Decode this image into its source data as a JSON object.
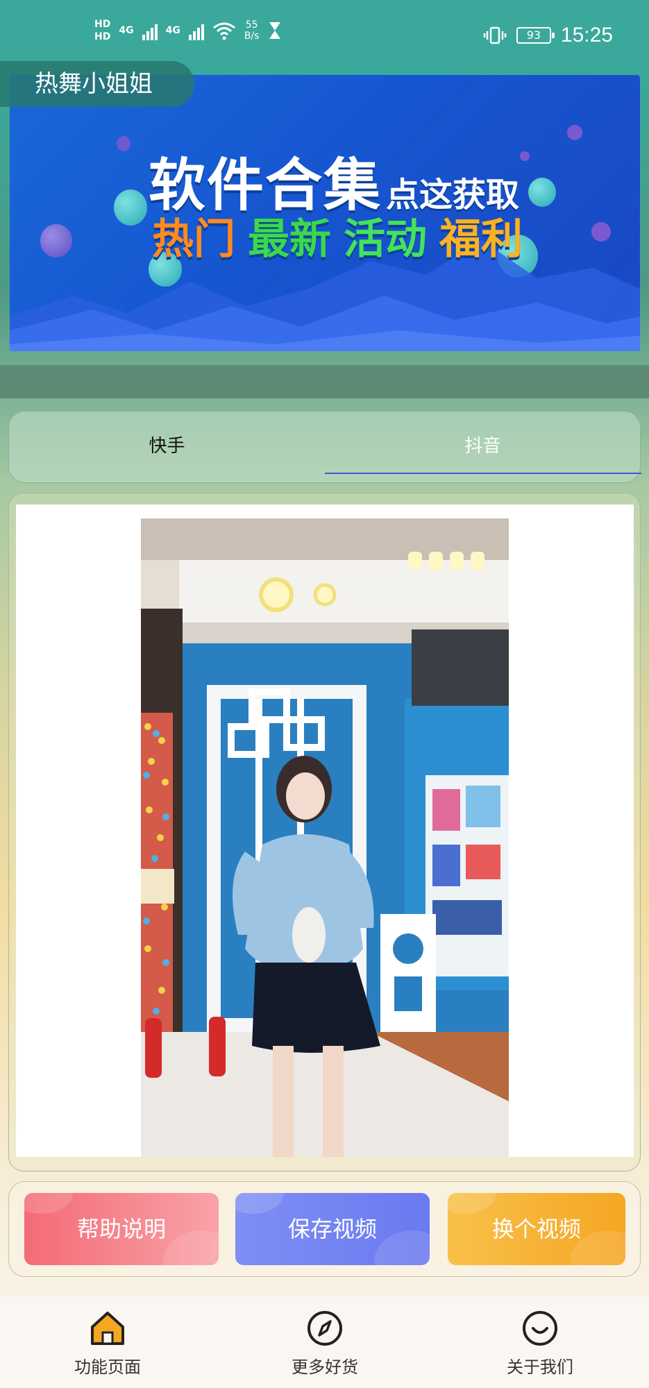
{
  "status_bar": {
    "hd1": "HD",
    "hd2": "HD",
    "net1": "4G",
    "net2": "4G",
    "speed_value": "55",
    "speed_unit": "B/s",
    "battery": "93",
    "time": "15:25"
  },
  "header": {
    "title": "热舞小姐姐"
  },
  "banner": {
    "title_big": "软件合集",
    "title_small": "点这获取",
    "tags": [
      {
        "text": "热门",
        "color": "#ff8a1e"
      },
      {
        "text": "最新",
        "color": "#3ad94a"
      },
      {
        "text": "活动",
        "color": "#44e35a"
      },
      {
        "text": "福利",
        "color": "#ffb21f"
      }
    ]
  },
  "tabs": [
    {
      "label": "快手",
      "active": false
    },
    {
      "label": "抖音",
      "active": true
    }
  ],
  "actions": {
    "help": "帮助说明",
    "save": "保存视频",
    "switch": "换个视频"
  },
  "bottom_nav": [
    {
      "label": "功能页面",
      "icon": "home-icon"
    },
    {
      "label": "更多好货",
      "icon": "compass-icon"
    },
    {
      "label": "关于我们",
      "icon": "smile-icon"
    }
  ],
  "colors": {
    "accent_blue": "#3b5bcf",
    "help_red": "#f36b76",
    "save_purple": "#7f8ef5",
    "switch_orange": "#f5a623"
  }
}
